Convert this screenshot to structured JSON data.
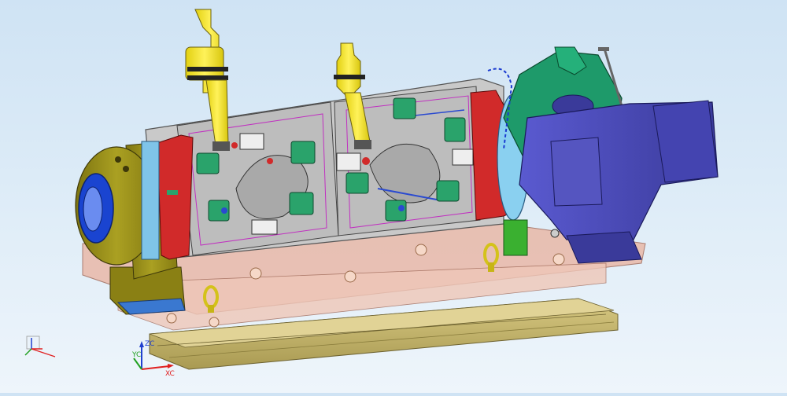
{
  "viewport": {
    "background_top": "#cfe3f4",
    "background_bottom": "#eef5fb"
  },
  "triad": {
    "main_label_z": "ZC",
    "main_label_y": "YC",
    "main_label_x": "XC",
    "x_color": "#e02020",
    "y_color": "#20a020",
    "z_color": "#2040d0"
  },
  "colors": {
    "base_tan": "#c9b870",
    "plate_pink": "#e9b8a8",
    "tailstock_olive": "#9a8f1a",
    "fixture_gray": "#b8b8b8",
    "clamp_green": "#2aa36b",
    "rotary_red": "#d12a2a",
    "motor_blue": "#4a4ab8",
    "housing_green": "#1e9a6a",
    "tool_yellow": "#f2e21a"
  },
  "icons": [
    "cad-model-icon",
    "coordinate-triad-icon",
    "mini-triad-icon"
  ]
}
